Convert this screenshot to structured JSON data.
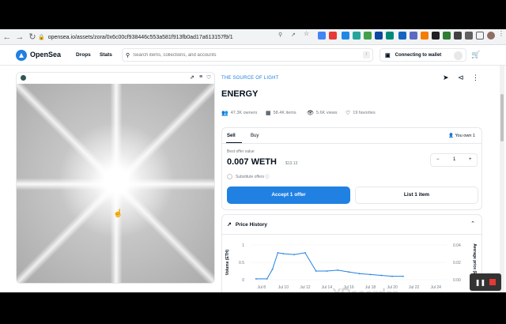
{
  "browser": {
    "url": "opensea.io/assets/zora/0x6c00cf938446c553a581f913fb0ad17a613157f9/1"
  },
  "header": {
    "brand": "OpenSea",
    "nav": [
      "Drops",
      "Stats"
    ],
    "search_placeholder": "Search items, collections, and accounts",
    "search_shortcut": "/",
    "wallet_label": "Connecting to wallet"
  },
  "item": {
    "collection": "THE SOURCE OF LIGHT",
    "title": "ENERGY",
    "owners": "47.3K owners",
    "items": "58.4K items",
    "views": "5.6K views",
    "favorites": "19 favorites"
  },
  "trade": {
    "tabs": [
      "Sell",
      "Buy"
    ],
    "you_own": "You own 1",
    "best_offer_label": "Best offer value",
    "best_offer_price": "0.007 WETH",
    "best_offer_usd": "$13.13",
    "substitute_label": "Substitute offers",
    "quantity": "1",
    "accept_label": "Accept 1 offer",
    "list_label": "List 1 item"
  },
  "price_history": {
    "title": "Price History"
  },
  "chart_data": {
    "type": "line",
    "categories": [
      "Jul 8",
      "Jul 10",
      "Jul 12",
      "Jul 14",
      "Jul 16",
      "Jul 18",
      "Jul 20",
      "Jul 22",
      "Jul 24"
    ],
    "ylabel": "Volume (ETH)",
    "y2label": "Average price (ETH)",
    "y_ticks": [
      "1",
      "0.5",
      "0"
    ],
    "y2_ticks": [
      "0.04",
      "0.02",
      "0.00"
    ],
    "series": [
      {
        "name": "Average price (ETH)",
        "x": [
          7.5,
          8.5,
          9.0,
          9.5,
          10.0,
          11.0,
          12.0,
          13.0,
          14.0,
          15.0,
          16.0,
          17.0,
          18.0,
          19.0,
          20.0,
          21.0
        ],
        "values": [
          0.001,
          0.001,
          0.012,
          0.031,
          0.03,
          0.029,
          0.031,
          0.01,
          0.01,
          0.011,
          0.009,
          0.007,
          0.006,
          0.005,
          0.004,
          0.004
        ]
      }
    ],
    "colors": {
      "line": "#2081e2",
      "bars": "#c7d8ec"
    }
  },
  "overlay": {
    "watermark": "XRecorder"
  }
}
